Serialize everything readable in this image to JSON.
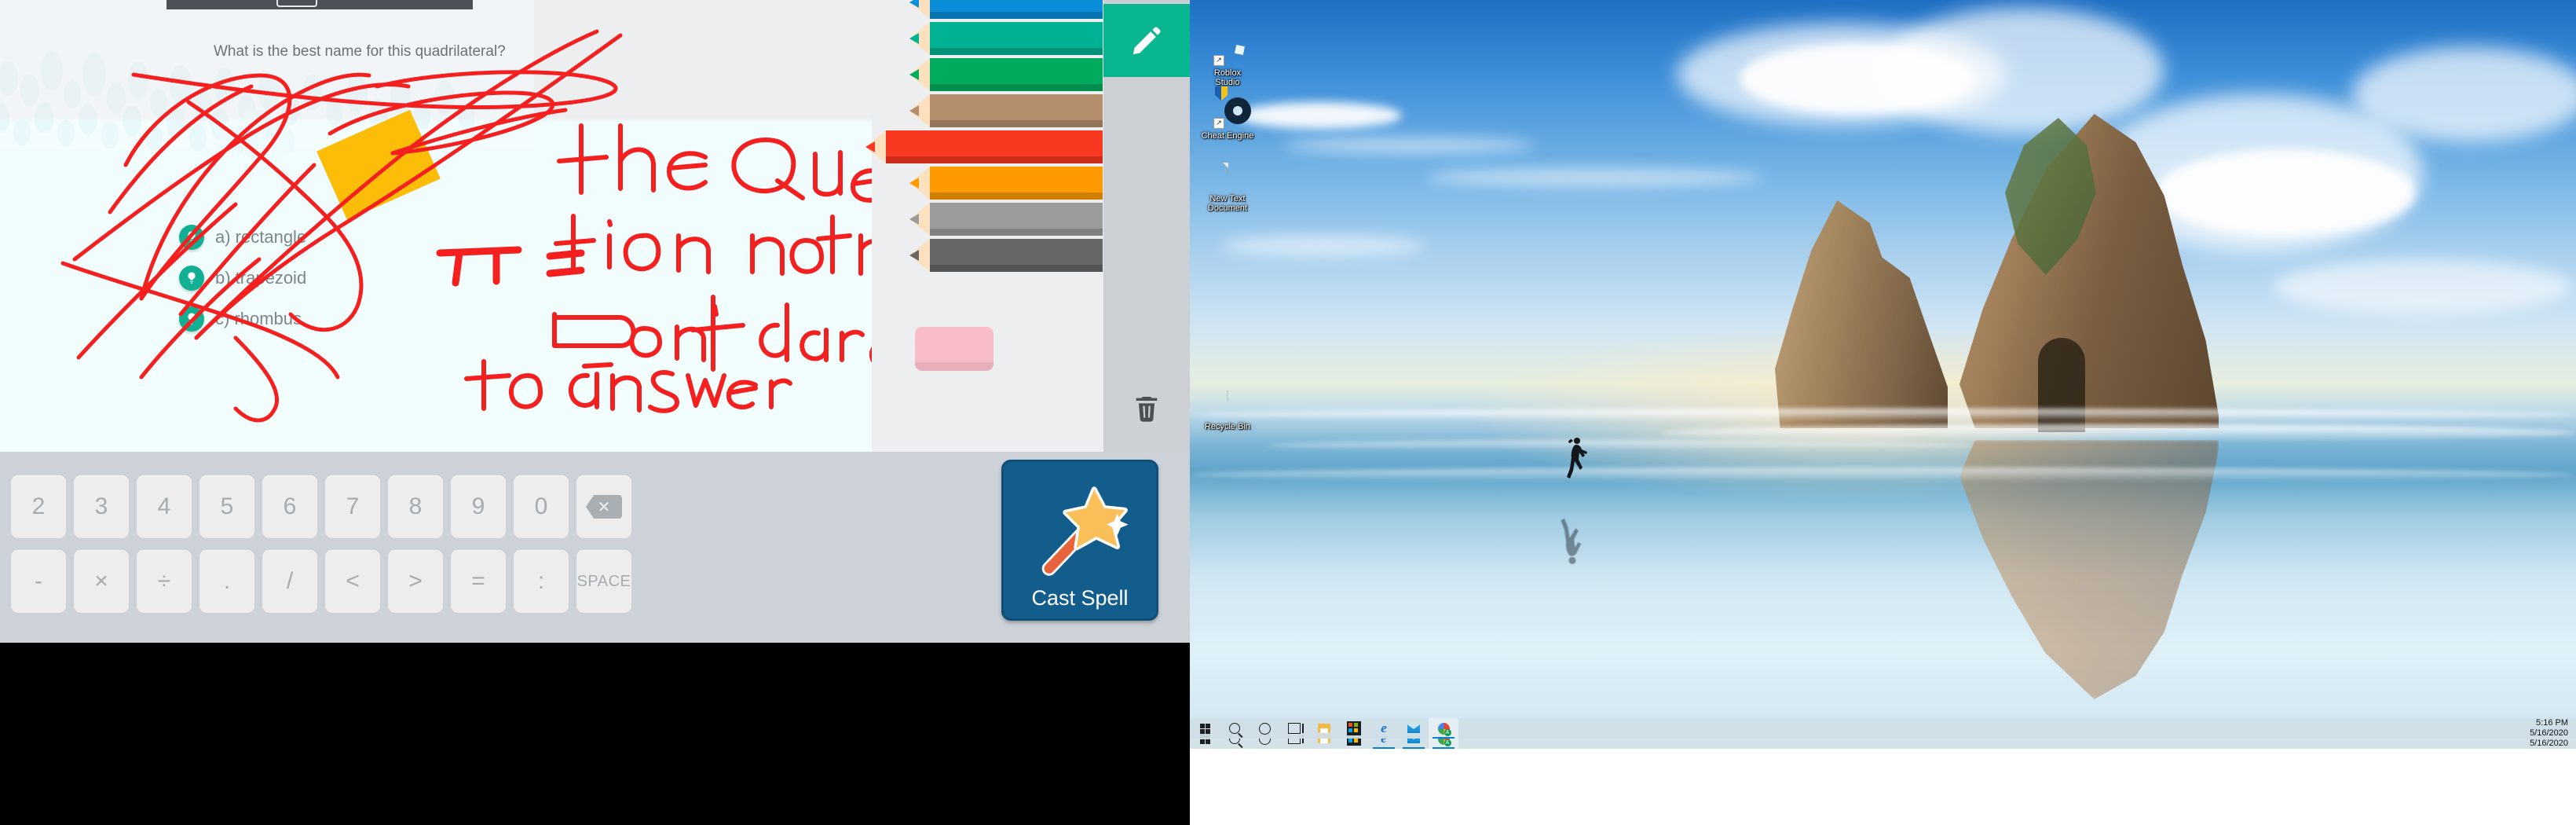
{
  "quiz": {
    "question": "What is the best name for this quadrilateral?",
    "answers": [
      {
        "label": "a) rectangle",
        "icon": "lightbulb-icon"
      },
      {
        "label": "b) trapezoid",
        "icon": "lightbulb-icon"
      },
      {
        "label": "c) rhombus",
        "icon": "lightbulb-icon"
      }
    ],
    "ink_notes": [
      "the Ques",
      "tion nothing",
      "Don't dare",
      "to answer",
      "π ="
    ],
    "ink_color": "#f42020",
    "highlight_shape_color": "#fbbd08"
  },
  "palette": {
    "title": "color-pencils",
    "selected_index": 4,
    "pencils": [
      {
        "name": "blue",
        "color": "#0a8ed9",
        "shade": "#0277bd",
        "selected": false
      },
      {
        "name": "teal",
        "color": "#00b294",
        "shade": "#009b80",
        "selected": false
      },
      {
        "name": "green",
        "color": "#00ab5e",
        "shade": "#009150",
        "selected": false
      },
      {
        "name": "brown",
        "color": "#b58e6c",
        "shade": "#a07c5c",
        "selected": false
      },
      {
        "name": "red",
        "color": "#f93822",
        "shade": "#dd3420",
        "selected": true
      },
      {
        "name": "orange",
        "color": "#fe9a00",
        "shade": "#e08800",
        "selected": false
      },
      {
        "name": "light-gray",
        "color": "#9b9b9b",
        "shade": "#848484",
        "selected": false
      },
      {
        "name": "dark-gray",
        "color": "#666666",
        "shade": "#585858",
        "selected": false
      }
    ],
    "eraser": {
      "name": "eraser",
      "color": "#f9bdc8"
    }
  },
  "tools": {
    "pen": {
      "name": "pen-tool",
      "color": "#08b68f"
    },
    "trash": {
      "name": "trash-tool",
      "color": "#4a4f54"
    }
  },
  "keyboard": {
    "row1": [
      "2",
      "3",
      "4",
      "5",
      "6",
      "7",
      "8",
      "9",
      "0",
      "⌫"
    ],
    "row2": [
      "-",
      "×",
      "÷",
      ".",
      "/",
      "<",
      ">",
      "=",
      ":",
      "SPACE"
    ],
    "backspace_label": "⌫",
    "space_label": "SPACE",
    "cast_spell": {
      "label": "Cast Spell",
      "icon": "magic-wand-icon",
      "background": "#125d8c"
    }
  },
  "desktop": {
    "wallpaper": "beach-rock-arch-runner",
    "icons": [
      {
        "name": "roblox-studio",
        "label": "Roblox\nStudio",
        "line1": "Roblox",
        "line2": "Studio",
        "shortcut": true
      },
      {
        "name": "cheat-engine",
        "label": "Cheat Engine",
        "line1": "Cheat Engine",
        "line2": "",
        "shortcut": true
      },
      {
        "name": "new-text-document",
        "label": "New Text Document",
        "line1": "New Text",
        "line2": "Document",
        "shortcut": false
      },
      {
        "name": "recycle-bin",
        "label": "Recycle Bin",
        "line1": "Recycle Bin",
        "line2": "",
        "shortcut": false
      }
    ]
  },
  "taskbar": {
    "items": [
      {
        "name": "start-button",
        "icon": "windows-logo-icon"
      },
      {
        "name": "search-button",
        "icon": "magnifier-icon"
      },
      {
        "name": "cortana-button",
        "icon": "circle-icon"
      },
      {
        "name": "task-view-button",
        "icon": "task-view-icon"
      },
      {
        "name": "file-explorer-button",
        "icon": "folder-icon"
      },
      {
        "name": "microsoft-store-button",
        "icon": "store-icon"
      },
      {
        "name": "edge-button",
        "icon": "edge-icon"
      },
      {
        "name": "mail-button",
        "icon": "mail-icon"
      },
      {
        "name": "chrome-button",
        "icon": "chrome-icon"
      }
    ],
    "clock": {
      "time": "5:16 PM",
      "date": "5/16/2020"
    }
  }
}
